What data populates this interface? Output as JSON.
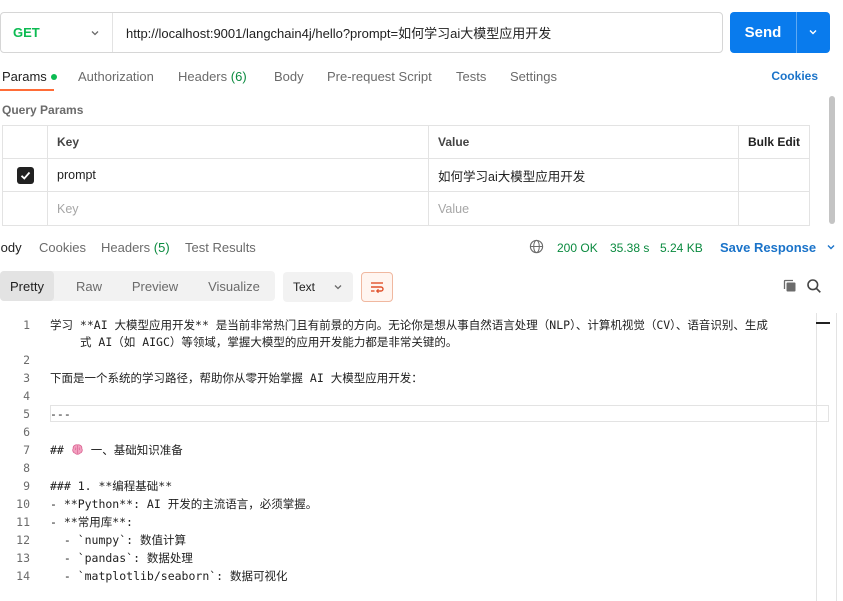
{
  "request": {
    "method": "GET",
    "url": "http://localhost:9001/langchain4j/hello?prompt=如何学习ai大模型应用开发",
    "send_label": "Send"
  },
  "request_tabs": {
    "params": "Params",
    "authorization": "Authorization",
    "headers": "Headers",
    "headers_count": "(6)",
    "body": "Body",
    "prerequest": "Pre-request Script",
    "tests": "Tests",
    "settings": "Settings",
    "cookies": "Cookies"
  },
  "query_params": {
    "title": "Query Params",
    "headers": {
      "key": "Key",
      "value": "Value",
      "bulk": "Bulk Edit"
    },
    "rows": [
      {
        "key": "prompt",
        "value": "如何学习ai大模型应用开发",
        "checked": true
      }
    ],
    "placeholder_key": "Key",
    "placeholder_value": "Value"
  },
  "response_tabs": {
    "body": "Body",
    "cookies": "Cookies",
    "headers": "Headers",
    "headers_count": "(5)",
    "test_results": "Test Results",
    "status": "200 OK",
    "time": "35.38 s",
    "size": "5.24 KB",
    "save_response": "Save Response"
  },
  "view": {
    "pretty": "Pretty",
    "raw": "Raw",
    "preview": "Preview",
    "visualize": "Visualize",
    "format": "Text"
  },
  "colors": {
    "accent": "#097bed",
    "method": "#0cbb52",
    "tab_underline": "#ff6c37",
    "link": "#1a73c9"
  },
  "code_lines": [
    {
      "n": "1",
      "text": "学习 **AI 大模型应用开发** 是当前非常热门且有前景的方向。无论你是想从事自然语言处理（NLP）、计算机视觉（CV）、语音识别、生成"
    },
    {
      "n": "",
      "text": "式 AI（如 AIGC）等领域，掌握大模型的应用开发能力都是非常关键的。"
    },
    {
      "n": "2",
      "text": ""
    },
    {
      "n": "3",
      "text": "下面是一个系统的学习路径，帮助你从零开始掌握 AI 大模型应用开发："
    },
    {
      "n": "4",
      "text": ""
    },
    {
      "n": "5",
      "text": "---"
    },
    {
      "n": "6",
      "text": ""
    },
    {
      "n": "7",
      "text_pre": "## ",
      "text_post": " 一、基础知识准备"
    },
    {
      "n": "8",
      "text": ""
    },
    {
      "n": "9",
      "text": "### 1. **编程基础**"
    },
    {
      "n": "10",
      "text": "- **Python**: AI 开发的主流语言，必须掌握。"
    },
    {
      "n": "11",
      "text": "- **常用库**:"
    },
    {
      "n": "12",
      "text": "  - `numpy`: 数值计算"
    },
    {
      "n": "13",
      "text": "  - `pandas`: 数据处理"
    },
    {
      "n": "14",
      "text": "  - `matplotlib/seaborn`: 数据可视化"
    }
  ]
}
